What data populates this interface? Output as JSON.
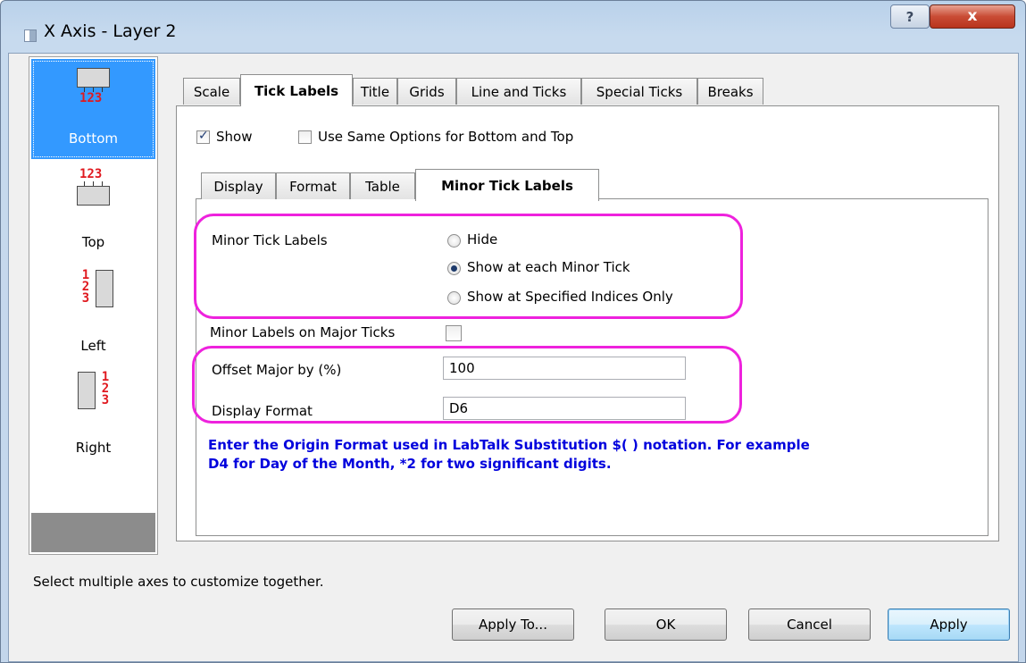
{
  "window": {
    "title": "X Axis - Layer 2",
    "help": "?",
    "close": "x"
  },
  "axes": [
    {
      "label": "Bottom",
      "icon_text": "123",
      "selected": true
    },
    {
      "label": "Top",
      "icon_text": "123",
      "selected": false
    },
    {
      "label": "Left",
      "icon_text": "123",
      "selected": false
    },
    {
      "label": "Right",
      "icon_text": "123",
      "selected": false
    }
  ],
  "tabs": [
    {
      "label": "Scale"
    },
    {
      "label": "Tick Labels",
      "active": true
    },
    {
      "label": "Title"
    },
    {
      "label": "Grids"
    },
    {
      "label": "Line and Ticks"
    },
    {
      "label": "Special Ticks"
    },
    {
      "label": "Breaks"
    }
  ],
  "options": {
    "show_label": "Show",
    "show_checked": true,
    "same_options_label": "Use Same Options for Bottom and Top",
    "same_options_checked": false
  },
  "subtabs": [
    {
      "label": "Display"
    },
    {
      "label": "Format"
    },
    {
      "label": "Table"
    },
    {
      "label": "Minor Tick Labels",
      "active": true
    }
  ],
  "minor": {
    "label": "Minor Tick Labels",
    "radios": [
      {
        "label": "Hide",
        "selected": false
      },
      {
        "label": "Show at each Minor Tick",
        "selected": true
      },
      {
        "label": "Show at Specified Indices Only",
        "selected": false
      }
    ],
    "on_major_label": "Minor Labels on Major Ticks",
    "on_major_checked": false,
    "offset_label": "Offset Major by (%)",
    "offset_value": "100",
    "format_label": "Display Format",
    "format_value": "D6",
    "note_line1": "Enter the Origin Format used in LabTalk Substitution $( ) notation. For example",
    "note_line2": "D4 for Day of the Month, *2 for two significant digits."
  },
  "status": "Select multiple axes to customize together.",
  "buttons": {
    "apply_to": "Apply To...",
    "ok": "OK",
    "cancel": "Cancel",
    "apply": "Apply"
  },
  "colors": {
    "highlight": "#ee22dd",
    "note": "#0000dd",
    "selection": "#3399ff",
    "icon_numbers": "#e0191f"
  }
}
